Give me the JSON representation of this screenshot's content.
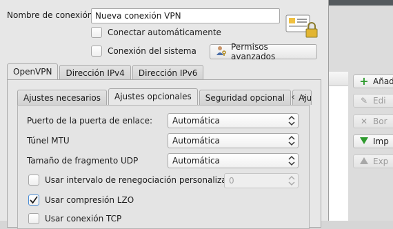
{
  "connection": {
    "name_label": "Nombre de conexión:",
    "name_value": "Nueva conexión VPN",
    "auto_connect_label": "Conectar automáticamente",
    "system_connection_label": "Conexión del sistema",
    "advanced_permissions_label": "Permisos avanzados"
  },
  "main_tabs": [
    {
      "label": "OpenVPN",
      "active": true
    },
    {
      "label": "Dirección IPv4",
      "active": false
    },
    {
      "label": "Dirección IPv6",
      "active": false
    }
  ],
  "sub_tabs": [
    {
      "label": "Ajustes necesarios",
      "active": false
    },
    {
      "label": "Ajustes opcionales",
      "active": true
    },
    {
      "label": "Seguridad opcional",
      "active": false
    },
    {
      "label": "Aju",
      "active": false
    }
  ],
  "options": {
    "gateway_port_label": "Puerto de la puerta de enlace:",
    "gateway_port_value": "Automática",
    "tunnel_mtu_label": "Túnel MTU",
    "tunnel_mtu_value": "Automática",
    "udp_fragment_label": "Tamaño de fragmento UDP",
    "udp_fragment_value": "Automática",
    "reneg_label": "Usar intervalo de renegociación personalizado",
    "reneg_value": "0",
    "reneg_checked": false,
    "lzo_label": "Usar compresión LZO",
    "lzo_checked": true,
    "tcp_label": "Usar conexión TCP",
    "tcp_checked": false
  },
  "background_window": {
    "buttons": [
      {
        "label": "Añad",
        "icon": "plus-icon",
        "enabled": true
      },
      {
        "label": "Edi",
        "icon": "edit-icon",
        "enabled": false
      },
      {
        "label": "Bor",
        "icon": "delete-icon",
        "enabled": false
      },
      {
        "label": "Imp",
        "icon": "import-icon",
        "enabled": true
      },
      {
        "label": "Exp",
        "icon": "export-icon",
        "enabled": false
      }
    ]
  },
  "colors": {
    "plus_icon": "#2e9a2e",
    "import_icon": "#2e9a2e",
    "checkbox_checked_border": "#4a8dd6"
  }
}
